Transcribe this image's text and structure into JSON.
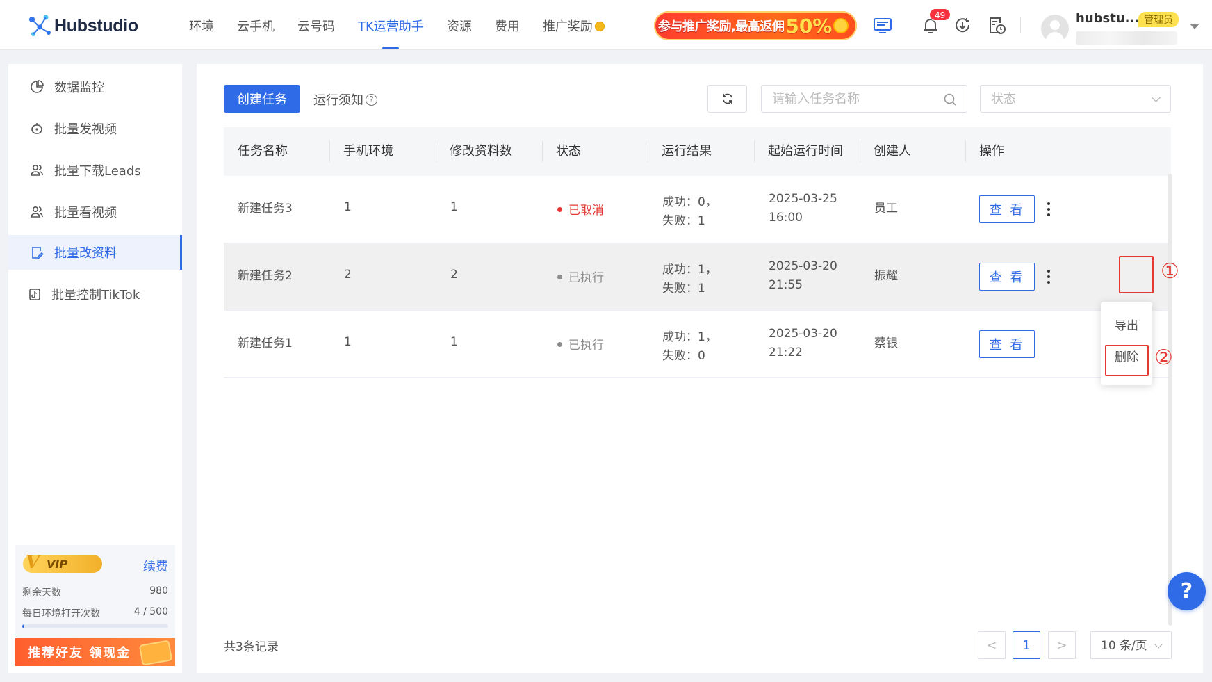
{
  "app": {
    "logo_text": "Hubstudio"
  },
  "nav": [
    {
      "label": "环境"
    },
    {
      "label": "云手机"
    },
    {
      "label": "云号码"
    },
    {
      "label": "TK运营助手",
      "active": true
    },
    {
      "label": "资源"
    },
    {
      "label": "费用"
    },
    {
      "label": "推广奖励"
    }
  ],
  "promo": {
    "text": "参与推广奖励,最高返佣",
    "percent": "50%"
  },
  "header": {
    "notification_count": "49",
    "username": "hubstu...",
    "role": "管理员"
  },
  "sidebar": {
    "items": [
      {
        "label": "数据监控",
        "icon": "chart-pie-icon"
      },
      {
        "label": "批量发视频",
        "icon": "robot-icon"
      },
      {
        "label": "批量下载Leads",
        "icon": "users-icon"
      },
      {
        "label": "批量看视频",
        "icon": "users-icon"
      },
      {
        "label": "批量改资料",
        "icon": "edit-doc-icon",
        "active": true
      },
      {
        "label": "批量控制TikTok",
        "icon": "tiktok-icon"
      }
    ],
    "vip": {
      "badge": "VIP",
      "renew": "续费",
      "days_label": "剩余天数",
      "days_value": "980",
      "opens_label": "每日环境打开次数",
      "opens_value": "4 / 500",
      "opens_fraction": 0.008,
      "refer_label": "推荐好友 领现金"
    }
  },
  "toolbar": {
    "create_label": "创建任务",
    "notice_label": "运行须知",
    "search_placeholder": "请输入任务名称",
    "status_placeholder": "状态"
  },
  "table": {
    "columns": [
      "任务名称",
      "手机环境",
      "修改资料数",
      "状态",
      "运行结果",
      "起始运行时间",
      "创建人",
      "操作"
    ],
    "rows": [
      {
        "name": "新建任务3",
        "env": "1",
        "count": "1",
        "status": "已取消",
        "status_color": "#e53935",
        "result_success": "成功：0，",
        "result_fail": "失败：1",
        "date": "2025-03-25",
        "time": "16:00",
        "creator": "员工",
        "action": "查 看"
      },
      {
        "name": "新建任务2",
        "env": "2",
        "count": "2",
        "status": "已执行",
        "status_color": "#8c8c8c",
        "result_success": "成功：1，",
        "result_fail": "失败：1",
        "date": "2025-03-20",
        "time": "21:55",
        "creator": "振耀",
        "action": "查 看"
      },
      {
        "name": "新建任务1",
        "env": "1",
        "count": "1",
        "status": "已执行",
        "status_color": "#8c8c8c",
        "result_success": "成功：1，",
        "result_fail": "失败：0",
        "date": "2025-03-20",
        "time": "21:22",
        "creator": "蔡银",
        "action": "查 看"
      }
    ]
  },
  "popup": {
    "export_label": "导出",
    "delete_label": "删除"
  },
  "annotations": {
    "step1": "①",
    "step2": "②"
  },
  "pagination": {
    "total_label": "共3条记录",
    "prev": "<",
    "current_page": "1",
    "next": ">",
    "page_size": "10 条/页"
  },
  "help": {
    "label": "?"
  }
}
